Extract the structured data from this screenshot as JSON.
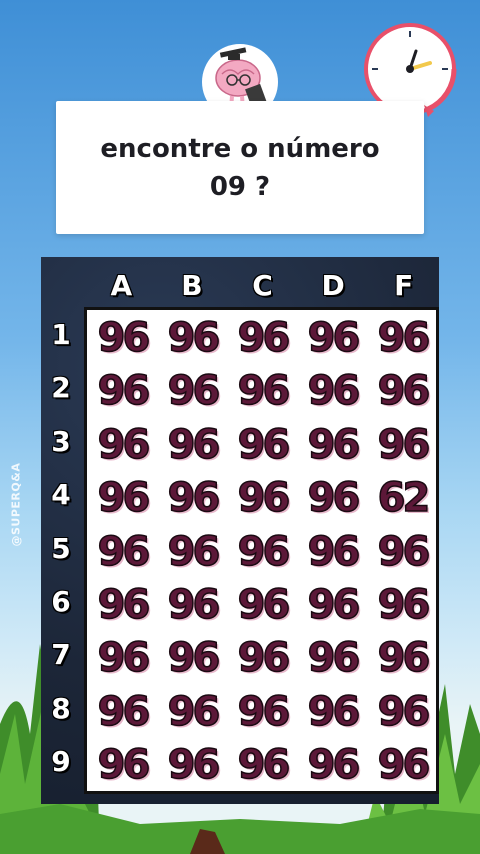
{
  "question": {
    "line1": "encontre o número",
    "line2": "09 ?"
  },
  "watermark": "@SUPERQ&A",
  "board": {
    "columns": [
      "A",
      "B",
      "C",
      "D",
      "F"
    ],
    "rows": [
      "1",
      "2",
      "3",
      "4",
      "5",
      "6",
      "7",
      "8",
      "9"
    ],
    "cells": [
      [
        "96",
        "96",
        "96",
        "96",
        "96"
      ],
      [
        "96",
        "96",
        "96",
        "96",
        "96"
      ],
      [
        "96",
        "96",
        "96",
        "96",
        "96"
      ],
      [
        "96",
        "96",
        "96",
        "96",
        "62"
      ],
      [
        "96",
        "96",
        "96",
        "96",
        "96"
      ],
      [
        "96",
        "96",
        "96",
        "96",
        "96"
      ],
      [
        "96",
        "96",
        "96",
        "96",
        "96"
      ],
      [
        "96",
        "96",
        "96",
        "96",
        "96"
      ],
      [
        "96",
        "96",
        "96",
        "96",
        "96"
      ]
    ]
  },
  "icons": {
    "timer": "clock-icon",
    "mascot": "brain-mascot-icon"
  },
  "colors": {
    "digit": "#5c1838",
    "board_bg": "#1f2b3f",
    "clock_accent": "#e8506a"
  }
}
